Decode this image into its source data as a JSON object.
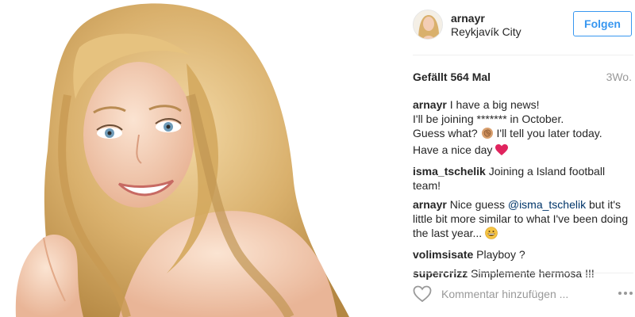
{
  "post": {
    "image_alt": "",
    "author": {
      "username": "arnayr",
      "location": "Reykjavík City",
      "follow_label": "Folgen"
    },
    "likes_label": "Gefällt 564 Mal",
    "time_ago": "3Wo.",
    "comments": [
      {
        "user": "arnayr",
        "lines": [
          "I have a big news!",
          "I'll be joining ******* in October.",
          "Guess what?"
        ],
        "after_emoji": "I'll tell you later today.",
        "last": "Have a nice day"
      },
      {
        "user": "isma_tschelik",
        "text": "Joining a Island football team!"
      },
      {
        "user": "arnayr",
        "pre": "Nice guess",
        "mention": "@isma_tschelik",
        "post": "but it's little bit more similar to what I've been doing the last year..."
      },
      {
        "user": "volimsisate",
        "text": "Playboy ?"
      },
      {
        "user": "supercrizz",
        "text": "Simplemente hermosa !!!"
      }
    ],
    "add_comment_placeholder": "Kommentar hinzufügen ...",
    "icons": {
      "like": "heart-outline-icon",
      "more": "more-options-icon",
      "emoji_hand": "clapping-hands-emoji-icon",
      "emoji_heart": "red-heart-emoji-icon",
      "emoji_grin": "grinning-face-emoji-icon"
    },
    "colors": {
      "link_blue": "#3897f0",
      "mention": "#003569",
      "muted": "#999999",
      "text": "#262626",
      "heart": "#e0245e"
    }
  }
}
